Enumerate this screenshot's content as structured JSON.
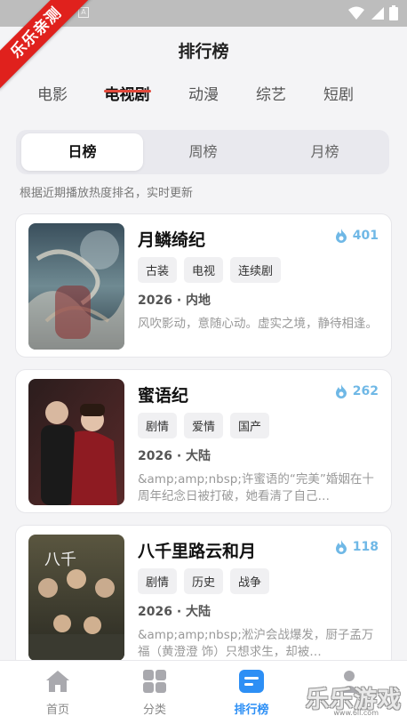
{
  "watermark_ribbon": "乐乐亲测",
  "header": {
    "title": "排行榜"
  },
  "categories": [
    {
      "label": "电影"
    },
    {
      "label": "电视剧",
      "active": true
    },
    {
      "label": "动漫"
    },
    {
      "label": "综艺"
    },
    {
      "label": "短剧"
    }
  ],
  "segments": [
    {
      "label": "日榜",
      "active": true
    },
    {
      "label": "周榜"
    },
    {
      "label": "月榜"
    }
  ],
  "hint": "根据近期播放热度排名，实时更新",
  "items": [
    {
      "title": "月鳞绮纪",
      "heat": "401",
      "tags": [
        "古装",
        "电视",
        "连续剧"
      ],
      "meta": "2026 · 内地",
      "desc": "风吹影动，意随心动。虚实之境，静待相逢。"
    },
    {
      "title": "蜜语纪",
      "heat": "262",
      "tags": [
        "剧情",
        "爱情",
        "国产"
      ],
      "meta": "2026 · 大陆",
      "desc": "&amp;amp;nbsp;许蜜语的“完美”婚姻在十周年纪念日被打破，她看清了自己…"
    },
    {
      "title": "八千里路云和月",
      "heat": "118",
      "tags": [
        "剧情",
        "历史",
        "战争"
      ],
      "meta": "2026 · 大陆",
      "desc": "&amp;amp;nbsp;淞沪会战爆发，厨子孟万福（黄澄澄 饰）只想求生，却被…"
    }
  ],
  "tabbar": [
    {
      "label": "首页",
      "icon": "home-icon"
    },
    {
      "label": "分类",
      "icon": "grid-icon"
    },
    {
      "label": "排行榜",
      "icon": "ranking-icon",
      "active": true
    },
    {
      "label": "",
      "icon": "profile-icon"
    }
  ],
  "site_watermark": {
    "text": "乐乐游戏",
    "url": "www.6ll.com"
  },
  "colors": {
    "accent": "#2d8ff5",
    "underline": "#e24a3c",
    "heat": "#6fb8e6",
    "ribbon": "#e0211d"
  }
}
